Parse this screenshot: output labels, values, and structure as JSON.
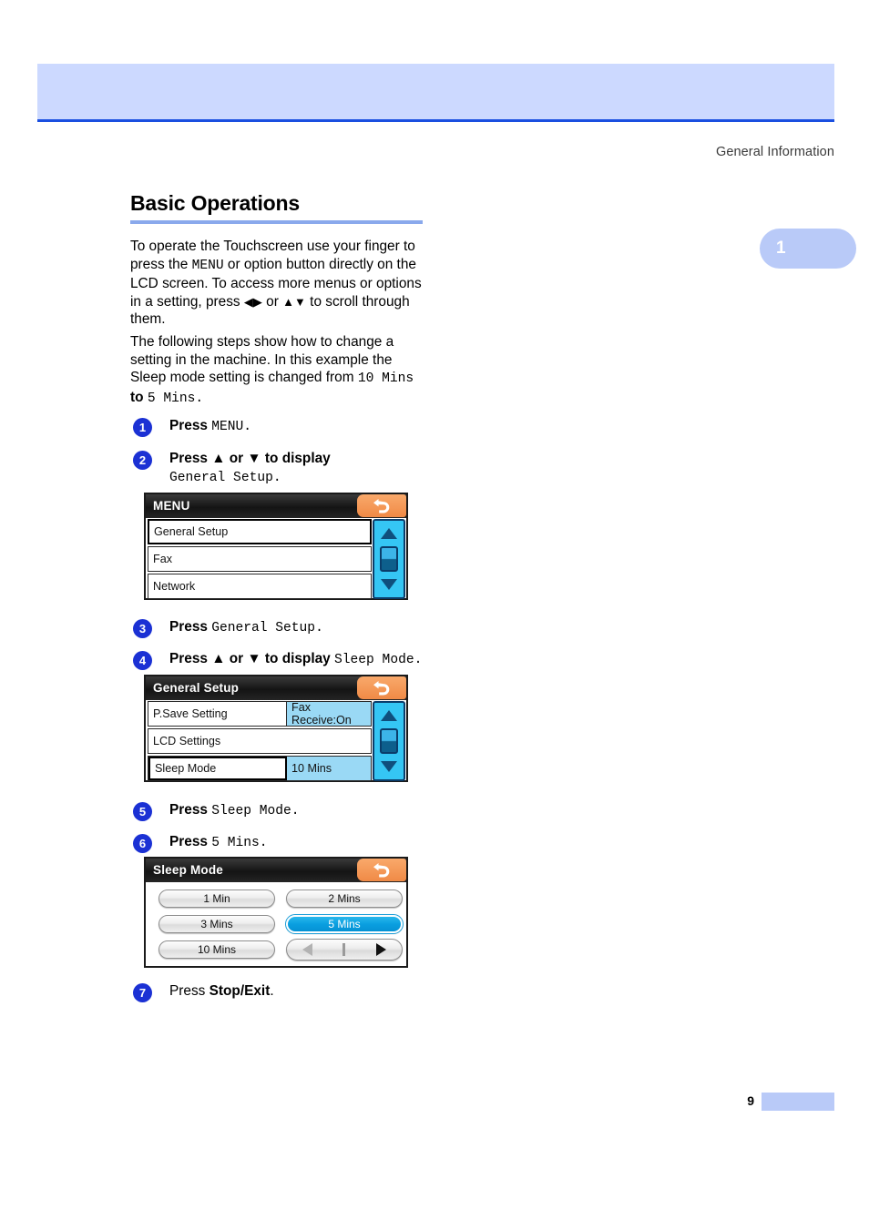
{
  "page": {
    "running_head": "General Information",
    "chapter_tab": "1",
    "page_number": "9"
  },
  "section": {
    "title": "Basic Operations",
    "paragraph_1_part1": "To operate the Touchscreen use your finger to press the ",
    "paragraph_1_menu": "MENU",
    "paragraph_1_part2": " or option button directly on the LCD screen. To access more menus or options in a setting, press ",
    "paragraph_1_arrows_lr": "◀▶",
    "paragraph_1_part3": " or ",
    "paragraph_1_arrows_ud": "▲▼",
    "paragraph_1_part4": " to scroll through them.",
    "paragraph_2_part1": "The following steps show how to change a setting in the machine. In this example the Sleep mode setting is changed from ",
    "paragraph_2_from": "10 Mins",
    "paragraph_2_mid": " to ",
    "paragraph_2_to": "5 Mins",
    "paragraph_2_end": "."
  },
  "steps": [
    {
      "number": "1",
      "lead": "Press ",
      "mono": "MENU",
      "tail": "."
    },
    {
      "number": "2",
      "lead": "Press ▲ or ▼ to display",
      "mono": "General Setup",
      "tail": "."
    },
    {
      "number": "3",
      "lead": "Press ",
      "mono": "General Setup",
      "tail": "."
    },
    {
      "number": "4",
      "lead": "Press ▲ or ▼ to display ",
      "mono": "Sleep Mode",
      "tail": "."
    },
    {
      "number": "5",
      "lead": "Press ",
      "mono": "Sleep Mode",
      "tail": "."
    },
    {
      "number": "6",
      "lead": "Press ",
      "mono": "5 Mins",
      "tail": "."
    },
    {
      "number": "7",
      "lead": "Press ",
      "bold": "Stop/Exit",
      "tail": "."
    }
  ],
  "lcd_menu": {
    "title": "MENU",
    "back_icon": "back-arrow-icon",
    "rows": [
      {
        "label": "General Setup",
        "value": "",
        "selected": true
      },
      {
        "label": "Fax",
        "value": "",
        "selected": false
      },
      {
        "label": "Network",
        "value": "",
        "selected": false
      }
    ],
    "scroll": {
      "up_icon": "triangle-up-icon",
      "down_icon": "triangle-down-icon"
    }
  },
  "lcd_general_setup": {
    "title": "General  Setup",
    "back_icon": "back-arrow-icon",
    "rows": [
      {
        "label": "P.Save Setting",
        "value": "Fax Receive:On",
        "selected": false
      },
      {
        "label": "LCD Settings",
        "value": "",
        "selected": false
      },
      {
        "label": "Sleep Mode",
        "value": "10 Mins",
        "selected": true
      }
    ],
    "scroll": {
      "up_icon": "triangle-up-icon",
      "down_icon": "triangle-down-icon"
    }
  },
  "lcd_sleep_mode": {
    "title": "Sleep Mode",
    "back_icon": "back-arrow-icon",
    "options": [
      {
        "label": "1 Min",
        "active": false
      },
      {
        "label": "2 Mins",
        "active": false
      },
      {
        "label": "3 Mins",
        "active": false
      },
      {
        "label": "5 Mins",
        "active": true
      },
      {
        "label": "10 Mins",
        "active": false
      }
    ],
    "pager": {
      "prev_icon": "arrow-left-icon",
      "next_icon": "arrow-right-icon"
    }
  },
  "colors": {
    "header_band": "#ccd9ff",
    "header_rule": "#1a4fe0",
    "section_rule": "#8aa9ec",
    "step_circle": "#1b31d4",
    "chapter_tab": "#b9caf8",
    "lcd_back_button": "#f08a46",
    "lcd_highlight": "#9ad9f5",
    "lcd_active_option": "#0a9fe0",
    "lcd_scroll": "#35c6f4"
  }
}
